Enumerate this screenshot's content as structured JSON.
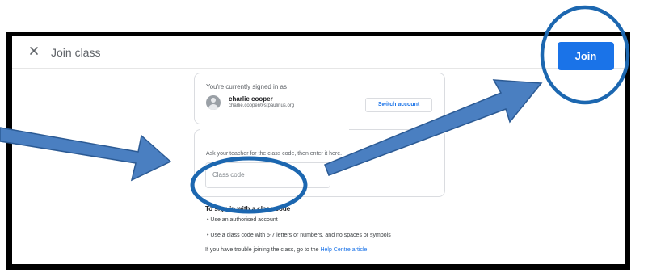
{
  "header": {
    "title": "Join class",
    "join_label": "Join"
  },
  "account": {
    "signed_in_label": "You're currently signed in as",
    "name": "charlie cooper",
    "email": "charlie.cooper@stpaulinus.org",
    "switch_label": "Switch account"
  },
  "class_code": {
    "instruction": "Ask your teacher for the class code, then enter it here.",
    "placeholder": "Class code"
  },
  "requirements": {
    "heading": "To sign in with a class code",
    "items": [
      "Use an authorised account",
      "Use a class code with 5-7 letters or numbers, and no spaces or symbols"
    ],
    "trouble_text": "If you have trouble joining the class, go to the ",
    "help_link": "Help Centre article"
  },
  "colors": {
    "accent": "#1a73e8",
    "annotation": "#1c67b0"
  },
  "icons": {
    "close": "close-icon",
    "avatar": "avatar-icon"
  }
}
